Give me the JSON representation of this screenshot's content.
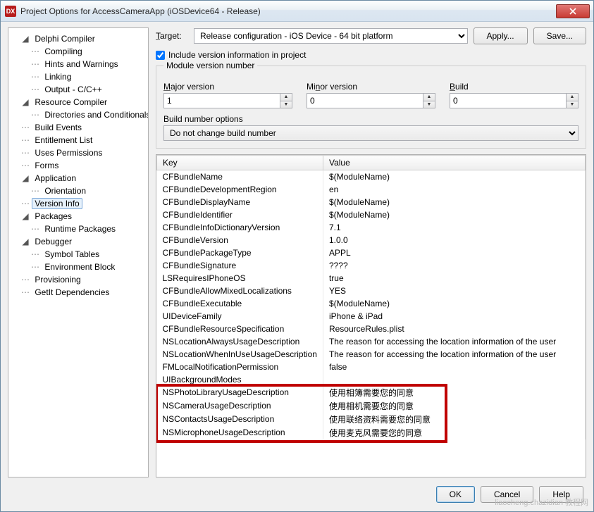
{
  "window": {
    "title": "Project Options for AccessCameraApp  (iOSDevice64 - Release)"
  },
  "buttons": {
    "apply": "Apply...",
    "save": "Save...",
    "ok": "OK",
    "cancel": "Cancel",
    "help": "Help"
  },
  "target": {
    "label": "Target:",
    "value": "Release configuration - iOS Device - 64 bit platform"
  },
  "checkbox": {
    "include_version": "Include version information in project",
    "checked": true
  },
  "module_version": {
    "legend": "Module version number",
    "major_label": "Major version",
    "major_value": "1",
    "minor_label": "Minor version",
    "minor_value": "0",
    "build_label": "Build",
    "build_value": "0",
    "bno_label": "Build number options",
    "bno_value": "Do not change build number"
  },
  "tree": [
    {
      "t": "Delphi Compiler",
      "d": 1,
      "exp": true
    },
    {
      "t": "Compiling",
      "d": 2
    },
    {
      "t": "Hints and Warnings",
      "d": 2
    },
    {
      "t": "Linking",
      "d": 2
    },
    {
      "t": "Output - C/C++",
      "d": 2
    },
    {
      "t": "Resource Compiler",
      "d": 1,
      "exp": true
    },
    {
      "t": "Directories and Conditionals",
      "d": 2
    },
    {
      "t": "Build Events",
      "d": 1,
      "leaf": true
    },
    {
      "t": "Entitlement List",
      "d": 1,
      "leaf": true
    },
    {
      "t": "Uses Permissions",
      "d": 1,
      "leaf": true
    },
    {
      "t": "Forms",
      "d": 1,
      "leaf": true
    },
    {
      "t": "Application",
      "d": 1,
      "exp": true
    },
    {
      "t": "Orientation",
      "d": 2
    },
    {
      "t": "Version Info",
      "d": 1,
      "sel": true,
      "leaf": true
    },
    {
      "t": "Packages",
      "d": 1,
      "exp": true
    },
    {
      "t": "Runtime Packages",
      "d": 2
    },
    {
      "t": "Debugger",
      "d": 1,
      "exp": true
    },
    {
      "t": "Symbol Tables",
      "d": 2
    },
    {
      "t": "Environment Block",
      "d": 2
    },
    {
      "t": "Provisioning",
      "d": 1,
      "leaf": true
    },
    {
      "t": "GetIt Dependencies",
      "d": 1,
      "leaf": true
    }
  ],
  "grid": {
    "headers": {
      "key": "Key",
      "value": "Value"
    },
    "rows": [
      {
        "k": "CFBundleName",
        "v": "$(ModuleName)"
      },
      {
        "k": "CFBundleDevelopmentRegion",
        "v": "en"
      },
      {
        "k": "CFBundleDisplayName",
        "v": "$(ModuleName)"
      },
      {
        "k": "CFBundleIdentifier",
        "v": "$(ModuleName)"
      },
      {
        "k": "CFBundleInfoDictionaryVersion",
        "v": "7.1"
      },
      {
        "k": "CFBundleVersion",
        "v": "1.0.0"
      },
      {
        "k": "CFBundlePackageType",
        "v": "APPL"
      },
      {
        "k": "CFBundleSignature",
        "v": "????"
      },
      {
        "k": "LSRequiresIPhoneOS",
        "v": "true"
      },
      {
        "k": "CFBundleAllowMixedLocalizations",
        "v": "YES"
      },
      {
        "k": "CFBundleExecutable",
        "v": "$(ModuleName)"
      },
      {
        "k": "UIDeviceFamily",
        "v": "iPhone & iPad"
      },
      {
        "k": "CFBundleResourceSpecification",
        "v": "ResourceRules.plist"
      },
      {
        "k": "NSLocationAlwaysUsageDescription",
        "v": "The reason for accessing the location information of the user"
      },
      {
        "k": "NSLocationWhenInUseUsageDescription",
        "v": "The reason for accessing the location information of the user"
      },
      {
        "k": "FMLocalNotificationPermission",
        "v": "false"
      },
      {
        "k": "UIBackgroundModes",
        "v": ""
      },
      {
        "k": "NSPhotoLibraryUsageDescription",
        "v": "使用相簿需要您的同意",
        "hl": true
      },
      {
        "k": "NSCameraUsageDescription",
        "v": "使用相机需要您的同意",
        "hl": true
      },
      {
        "k": "NSContactsUsageDescription",
        "v": "使用联络资料需要您的同意",
        "hl": true
      },
      {
        "k": "NSMicrophoneUsageDescription",
        "v": "使用麦克风需要您的同意",
        "hl": true
      }
    ]
  },
  "watermark": "liaocheng.chazidian 教程网"
}
